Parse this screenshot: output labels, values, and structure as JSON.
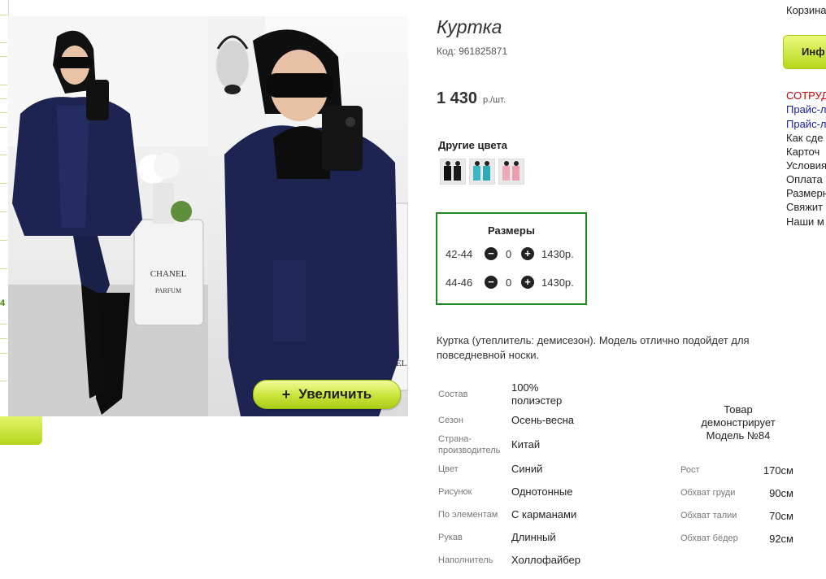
{
  "product": {
    "title": "Куртка",
    "code": "Код: 961825871",
    "price": "1 430",
    "price_unit": "р./шт.",
    "zoom_label": "Увеличить",
    "colors_title": "Другие цвета",
    "sizes_title": "Размеры",
    "sizes": [
      {
        "size": "42-44",
        "qty": "0",
        "price": "1430р."
      },
      {
        "size": "44-46",
        "qty": "0",
        "price": "1430р."
      }
    ],
    "description": "Куртка (утеплитель: демисезон). Модель отлично подойдет для повседневной носки."
  },
  "properties": [
    {
      "label": "Состав",
      "value": "100% полиэстер"
    },
    {
      "label": "Сезон",
      "value": "Осень-весна"
    },
    {
      "label": "Страна-производитель",
      "value": "Китай"
    },
    {
      "label": "Цвет",
      "value": "Синий"
    },
    {
      "label": "Рисунок",
      "value": "Однотонные"
    },
    {
      "label": "По элементам",
      "value": "С карманами"
    },
    {
      "label": "Рукав",
      "value": "Длинный"
    },
    {
      "label": "Наполнитель",
      "value": "Холлофайбер"
    }
  ],
  "model": {
    "note": "Товар демонстрирует Модель №84",
    "params": [
      {
        "label": "Рост",
        "value": "170см"
      },
      {
        "label": "Обхват груди",
        "value": "90см"
      },
      {
        "label": "Обхват талии",
        "value": "70см"
      },
      {
        "label": "Обхват бёдер",
        "value": "92см"
      }
    ]
  },
  "sidebar_right": {
    "cart": "Корзина",
    "info_button": "Инф",
    "links": [
      {
        "text": "СОТРУД",
        "color": "#cc0000"
      },
      {
        "text": "Прайс-л",
        "color": "#1a1aa6"
      },
      {
        "text": "Прайс-л",
        "color": "#1a1aa6"
      },
      {
        "text": "Как сде",
        "color": "#222222"
      },
      {
        "text": "Карточ",
        "color": "#222222"
      },
      {
        "text": "Условия",
        "color": "#222222"
      },
      {
        "text": "Оплата",
        "color": "#222222"
      },
      {
        "text": "Размерн",
        "color": "#222222"
      },
      {
        "text": "Свяжит",
        "color": "#222222"
      },
      {
        "text": "Наши м",
        "color": "#222222"
      }
    ]
  },
  "sidebar_left": {
    "number": "4"
  },
  "colors": {
    "accent_green": "#b8d91e",
    "size_border": "#1e8a1e",
    "jacket": "#1d2452"
  }
}
